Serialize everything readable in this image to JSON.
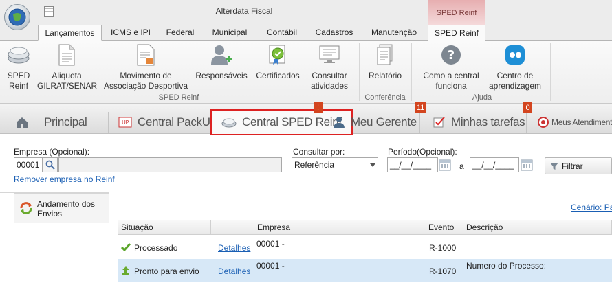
{
  "window": {
    "title": "Alterdata Fiscal",
    "context_tab": "SPED Reinf"
  },
  "ribbon_tabs": [
    "Lançamentos",
    "ICMS e IPI",
    "Federal",
    "Municipal",
    "Contábil",
    "Cadastros",
    "Manutenção",
    "SPED Reinf"
  ],
  "ribbon": {
    "buttons": {
      "sped_reinf": "SPED Reinf",
      "aliquota": "Aliquota GILRAT/SENAR",
      "movimento": "Movimento de Associação Desportiva",
      "responsaveis": "Responsáveis",
      "certificados": "Certificados",
      "consultar": "Consultar atividades",
      "relatorio": "Relatório",
      "como_funciona": "Como a central funciona",
      "centro_aprendizagem": "Centro de aprendizagem"
    },
    "groups": {
      "sped_reinf": "SPED Reinf",
      "conferencia": "Conferência",
      "ajuda": "Ajuda"
    }
  },
  "module_tabs": {
    "principal": "Principal",
    "central_packup": "Central PackUp",
    "central_sped_reinf": "Central SPED Reinf",
    "meu_gerente": "Meu Gerente",
    "minhas_tarefas": "Minhas tarefas",
    "meus_atendimentos": "Meus Atendiment"
  },
  "badges": {
    "central_sped_reinf": "!",
    "meu_gerente": "11",
    "minhas_tarefas": "0"
  },
  "filters": {
    "empresa_label": "Empresa (Opcional):",
    "empresa_code": "00001",
    "remove_link": "Remover empresa no Reinf",
    "consultar_label": "Consultar por:",
    "consultar_value": "Referência",
    "periodo_label": "Período(Opcional):",
    "date_from": "__/__/____",
    "date_to": "__/__/____",
    "a_label": "a",
    "filtrar": "Filtrar"
  },
  "left_panel": {
    "andamento": "Andamento dos Envios"
  },
  "cenario_link": "Cenário: Pa",
  "grid": {
    "headers": {
      "situacao": "Situação",
      "empresa": "Empresa",
      "evento": "Evento",
      "descricao": "Descrição"
    },
    "rows": [
      {
        "situacao": "Processado",
        "detalhes": "Detalhes",
        "empresa": "00001 -",
        "evento": "R-1000",
        "descricao": ""
      },
      {
        "situacao": "Pronto para envio",
        "detalhes": "Detalhes",
        "empresa": "00001 -",
        "evento": "R-1070",
        "descricao": "Numero do Processo:"
      }
    ]
  },
  "colors": {
    "accent_red": "#d22222",
    "link_blue": "#1a5fb4",
    "badge": "#d3451f",
    "selected_row": "#d7e8f7"
  }
}
